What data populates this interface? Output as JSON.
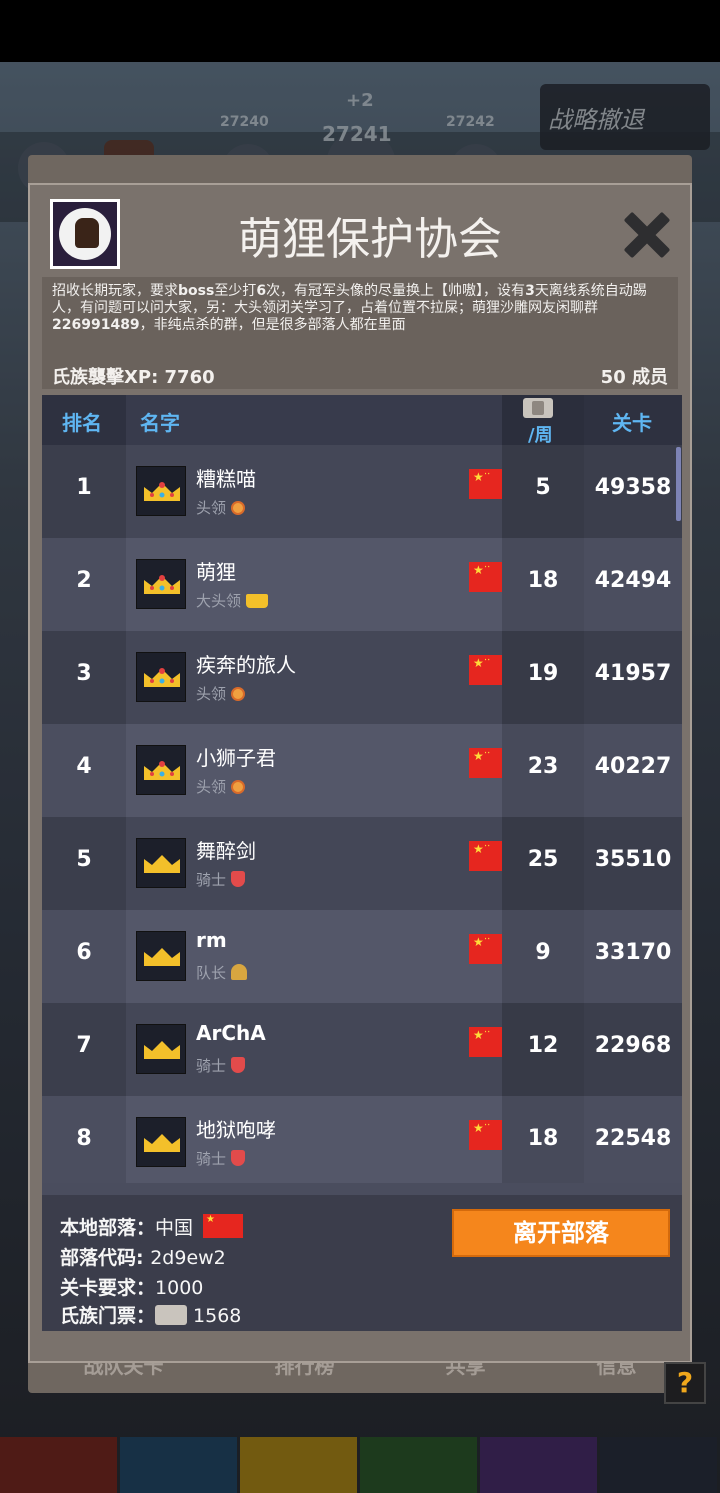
{
  "background": {
    "levels": [
      "27240",
      "27241",
      "27242"
    ],
    "stage_badge": "+2",
    "retreat_label": "战略撤退",
    "tab_labels": [
      "战队关卡",
      "排行榜",
      "共享",
      "信息"
    ],
    "tab_colors": [
      "#7a2a22",
      "#244a6b",
      "#b08a1a",
      "#2d5a2d",
      "#4b2f6e",
      "#2a3140"
    ]
  },
  "clan": {
    "name": "萌狸保护协会",
    "description_parts": [
      {
        "text": "招收长期玩家，要求",
        "bold": false
      },
      {
        "text": "boss",
        "bold": true
      },
      {
        "text": "至少打",
        "bold": false
      },
      {
        "text": "6",
        "bold": true
      },
      {
        "text": "次，有冠军头像的尽量换上【帅嗷】，设有",
        "bold": false
      },
      {
        "text": "3",
        "bold": true
      },
      {
        "text": "天离线系统自动踢人，有问题可以问大家，另：大头领闭关学习了，占着位置不拉屎；萌狸沙雕网友闲聊群",
        "bold": false
      },
      {
        "text": "226991489",
        "bold": true
      },
      {
        "text": "，非纯点杀的群，但是很多部落人都在里面",
        "bold": false
      }
    ],
    "xp_label": "氏族襲擊XP: 7760",
    "members_label": "50 成员"
  },
  "table": {
    "headers": {
      "rank": "排名",
      "name": "名字",
      "week": "/周",
      "level": "关卡"
    },
    "rows": [
      {
        "rank": "1",
        "name": "糟糕喵",
        "role": "头领",
        "badge": "medal",
        "crown": "gem",
        "week": "5",
        "level": "49358",
        "bold": false
      },
      {
        "rank": "2",
        "name": "萌狸",
        "role": "大头领",
        "badge": "crownb",
        "crown": "gem",
        "week": "18",
        "level": "42494",
        "bold": false
      },
      {
        "rank": "3",
        "name": "疾奔的旅人",
        "role": "头领",
        "badge": "medal",
        "crown": "gem",
        "week": "19",
        "level": "41957",
        "bold": false
      },
      {
        "rank": "4",
        "name": "小狮子君",
        "role": "头领",
        "badge": "medal",
        "crown": "gem",
        "week": "23",
        "level": "40227",
        "bold": false,
        "selected": true
      },
      {
        "rank": "5",
        "name": "舞醉剑",
        "role": "骑士",
        "badge": "shield",
        "crown": "plain",
        "week": "25",
        "level": "35510",
        "bold": false
      },
      {
        "rank": "6",
        "name": "rm",
        "role": "队长",
        "badge": "helmet",
        "crown": "plain",
        "week": "9",
        "level": "33170",
        "bold": true
      },
      {
        "rank": "7",
        "name": "ArChA",
        "role": "骑士",
        "badge": "shield",
        "crown": "plain",
        "week": "12",
        "level": "22968",
        "bold": true
      },
      {
        "rank": "8",
        "name": "地狱咆哮",
        "role": "骑士",
        "badge": "shield",
        "crown": "plain",
        "week": "18",
        "level": "22548",
        "bold": false
      }
    ]
  },
  "footer": {
    "region_label": "本地部落：",
    "region_value": "中国",
    "code_label": "部落代码: ",
    "code_value": "2d9ew2",
    "req_label": "关卡要求：",
    "req_value": "1000",
    "ticket_label": "氏族门票：",
    "ticket_value": "1568",
    "leave_button": "离开部落"
  },
  "help_label": "?",
  "colors": {
    "accent_header": "#5fb6f2",
    "leave_button": "#f5861c",
    "flag_red": "#e6261f"
  }
}
